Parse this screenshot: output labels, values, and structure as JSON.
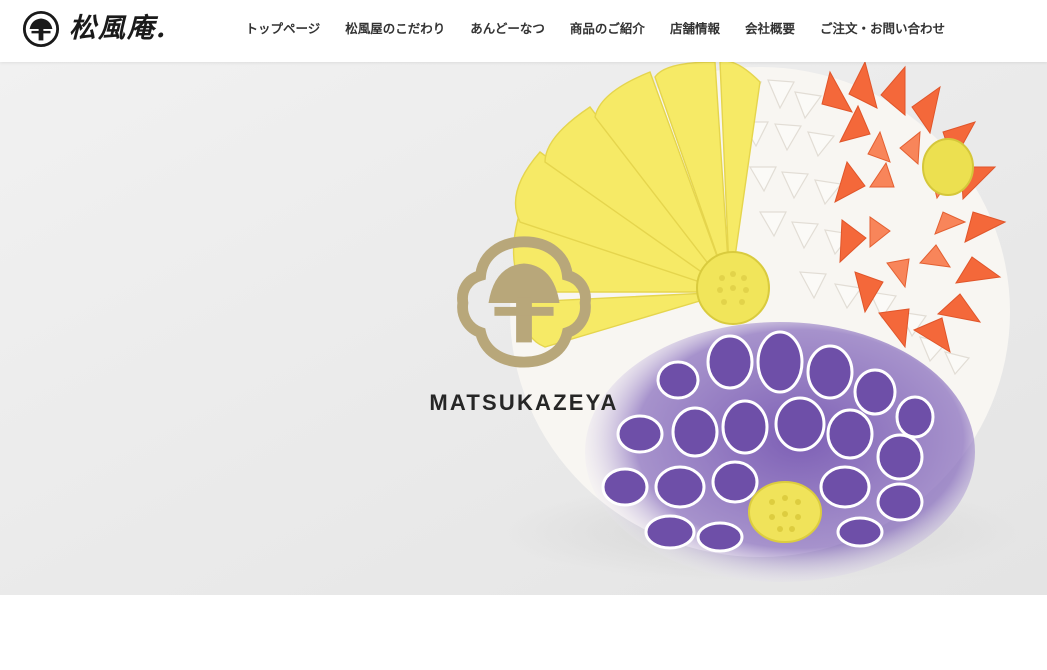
{
  "header": {
    "logo_text": "松風庵.",
    "nav": [
      "トップページ",
      "松風屋のこだわり",
      "あんどーなつ",
      "商品のご紹介",
      "店舗情報",
      "会社概要",
      "ご注文・お問い合わせ"
    ]
  },
  "hero": {
    "brand_name": "MATSUKAZEYA",
    "image_subject": "chrysanthemum wagashi",
    "colors": {
      "logo_mark": "#b8a77a",
      "yellow_petals": "#f7ec6a",
      "orange_petals": "#f46a35",
      "purple_petals": "#7a5ab0",
      "white_petals": "#f7f5f1",
      "background": "#ececec"
    }
  },
  "colors": {
    "header_background": "#ffffff",
    "nav_text": "#333333",
    "logo_text": "#1a1a1a"
  }
}
